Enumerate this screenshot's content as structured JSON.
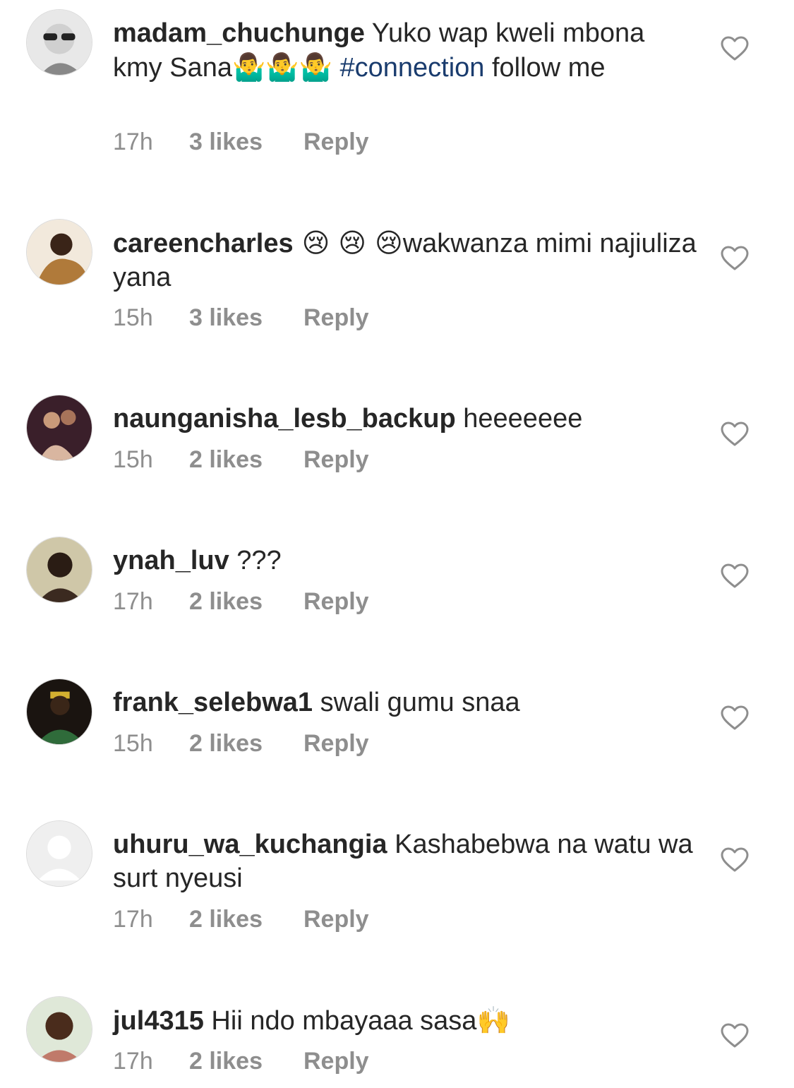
{
  "colors": {
    "text": "#262626",
    "meta": "#8e8e8e",
    "hashtag": "#1a3c6e",
    "background": "#ffffff"
  },
  "comments": [
    {
      "username": "madam_chuchunge",
      "text_1": " Yuko wap kweli mbona kmy Sana",
      "emoji_1": "🤷‍♂️🤷‍♂️🤷‍♂️",
      "hashtag": "#connection",
      "text_2": " follow me",
      "time": "17h",
      "likes": "3 likes",
      "reply": "Reply",
      "avatar_icon": "avatar-icon",
      "like_icon": "heart-outline-icon"
    },
    {
      "username": "careencharles",
      "emoji_1": " 😢 😢 😢",
      "text_1": "wakwanza mimi najiuliza yana",
      "time": "15h",
      "likes": "3 likes",
      "reply": "Reply"
    },
    {
      "username": "naunganisha_lesb_backup",
      "text_1": " heeeeeee",
      "time": "15h",
      "likes": "2 likes",
      "reply": "Reply"
    },
    {
      "username": "ynah_luv",
      "text_1": " ???",
      "time": "17h",
      "likes": "2 likes",
      "reply": "Reply"
    },
    {
      "username": "frank_selebwa1",
      "text_1": " swali gumu snaa",
      "time": "15h",
      "likes": "2 likes",
      "reply": "Reply"
    },
    {
      "username": "uhuru_wa_kuchangia",
      "text_1": " Kashabebwa na watu wa  surt nyeusi",
      "time": "17h",
      "likes": "2 likes",
      "reply": "Reply"
    },
    {
      "username": "jul4315",
      "text_1": " Hii ndo mbayaaa sasa",
      "emoji_1": "🙌",
      "time": "17h",
      "likes": "2 likes",
      "reply": "Reply"
    }
  ]
}
